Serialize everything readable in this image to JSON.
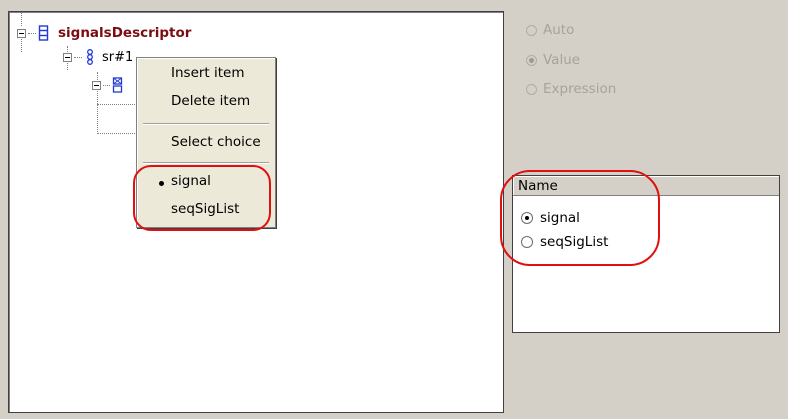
{
  "tree": {
    "root_label": "signalsDescriptor",
    "child_label": "sr#1"
  },
  "context_menu": {
    "items": [
      "Insert item",
      "Delete item",
      "Select choice"
    ],
    "choices": [
      "signal",
      "seqSigList"
    ],
    "selected_choice": "signal"
  },
  "value_mode": {
    "options": [
      "Auto",
      "Value",
      "Expression"
    ],
    "selected": "Value",
    "enabled": false
  },
  "choice_list": {
    "header": "Name",
    "rows": [
      "signal",
      "seqSigList"
    ],
    "selected": "signal"
  },
  "colors": {
    "annotation": "#e01010",
    "root_label": "#7a0d12",
    "tree_icon": "#1f39d6"
  }
}
